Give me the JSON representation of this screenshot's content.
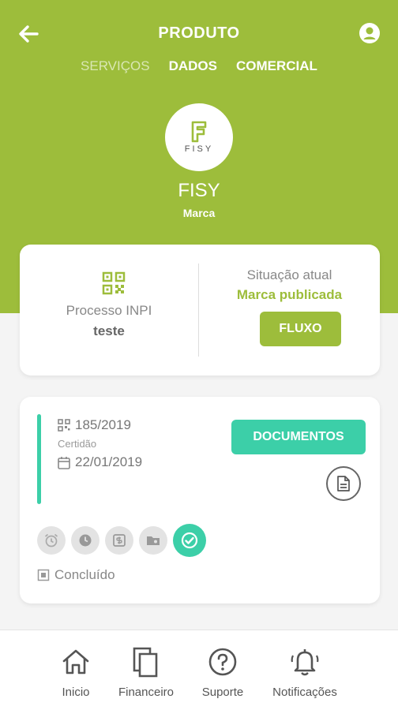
{
  "header": {
    "title": "PRODUTO",
    "tabs": [
      {
        "label": "SERVIÇOS",
        "active": false
      },
      {
        "label": "DADOS",
        "active": true
      },
      {
        "label": "COMERCIAL",
        "active": true
      }
    ],
    "logo_text": "FISY",
    "brand_name": "FISY",
    "brand_type": "Marca"
  },
  "inpi_card": {
    "process_label": "Processo INPI",
    "process_value": "teste",
    "situation_label": "Situação atual",
    "situation_value": "Marca publicada",
    "flow_button": "FLUXO"
  },
  "process_card": {
    "process_number": "185/2019",
    "type_label": "Certidão",
    "date": "22/01/2019",
    "documents_button": "DOCUMENTOS",
    "status_text": "Concluído",
    "status_icons": [
      "alarm-icon",
      "clock-icon",
      "money-icon",
      "folder-icon",
      "check-circle-icon"
    ]
  },
  "nav": {
    "items": [
      {
        "label": "Inicio",
        "icon": "home-icon"
      },
      {
        "label": "Financeiro",
        "icon": "copy-icon"
      },
      {
        "label": "Suporte",
        "icon": "help-circle-icon"
      },
      {
        "label": "Notificações",
        "icon": "bell-icon"
      }
    ]
  },
  "colors": {
    "primary_green": "#9dbd3b",
    "accent_teal": "#3ccfa8",
    "background": "#f4f4f4"
  }
}
